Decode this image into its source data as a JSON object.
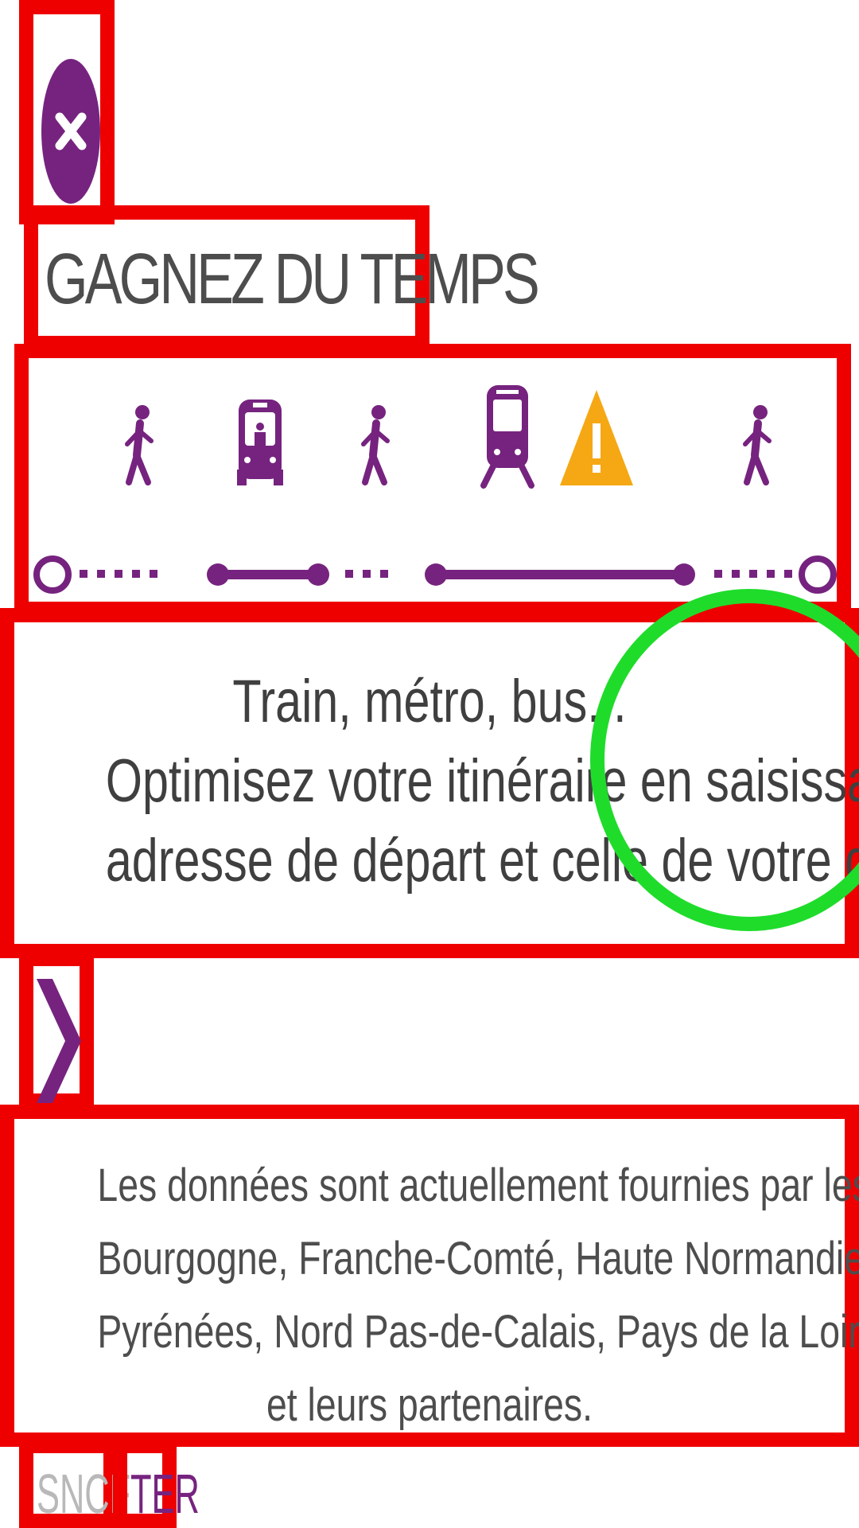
{
  "colors": {
    "brand": "#76237f",
    "warning": "#f5a814",
    "text": "#4d4d4d",
    "annotation_red": "#ee0000",
    "annotation_green": "#1fdc2b"
  },
  "close": {
    "icon": "close-icon"
  },
  "title": "GAGNEZ DU TEMPS",
  "itinerary": {
    "icons": [
      "walk-icon",
      "bus-icon",
      "walk-icon",
      "train-icon",
      "warning-icon",
      "walk-icon"
    ]
  },
  "description": {
    "line1": "Train, métro, bus...",
    "line2": "Optimisez votre itinéraire en saisissant votre",
    "line3": "adresse de départ et celle de votre destination."
  },
  "next": {
    "icon": "chevron-right-icon"
  },
  "providers": {
    "line1": "Les données sont actuellement fournies par les Régions",
    "line2": "Bourgogne, Franche-Comté, Haute Normandie, Lorraine, Midi",
    "line3": "Pyrénées, Nord Pas-de-Calais, Pays de la Loire, Poitou Charentes",
    "line4": "et leurs partenaires."
  },
  "footer": {
    "sncf": "SNCF",
    "ter": "TER"
  }
}
